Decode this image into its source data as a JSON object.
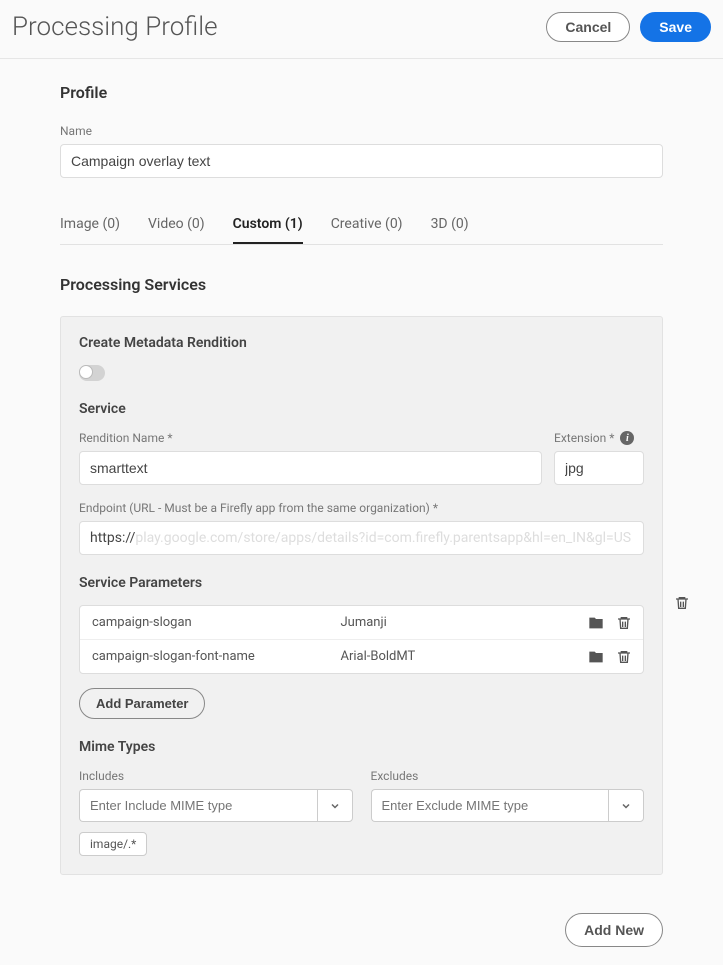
{
  "header": {
    "title": "Processing Profile",
    "cancel": "Cancel",
    "save": "Save"
  },
  "profile": {
    "section_title": "Profile",
    "name_label": "Name",
    "name_value": "Campaign overlay text"
  },
  "tabs": {
    "image": "Image (0)",
    "video": "Video (0)",
    "custom": "Custom (1)",
    "creative": "Creative (0)",
    "threeD": "3D (0)"
  },
  "services": {
    "title": "Processing Services",
    "metadata_heading": "Create Metadata Rendition",
    "service_heading": "Service",
    "rendition_label": "Rendition Name *",
    "rendition_value": "smarttext",
    "extension_label": "Extension *",
    "extension_value": "jpg",
    "endpoint_label": "Endpoint (URL - Must be a Firefly app from the same organization) *",
    "endpoint_prefix": "https://",
    "endpoint_rest": "play.google.com/store/apps/details?id=com.firefly.parentsapp&hl=en_IN&gl=US",
    "params_title": "Service Parameters",
    "params": [
      {
        "key": "campaign-slogan",
        "value": "Jumanji"
      },
      {
        "key": "campaign-slogan-font-name",
        "value": "Arial-BoldMT"
      }
    ],
    "add_param": "Add Parameter",
    "mime_title": "Mime Types",
    "includes_label": "Includes",
    "excludes_label": "Excludes",
    "includes_placeholder": "Enter Include MIME type",
    "excludes_placeholder": "Enter Exclude MIME type",
    "include_chip": "image/.*"
  },
  "footer": {
    "add_new": "Add New"
  }
}
